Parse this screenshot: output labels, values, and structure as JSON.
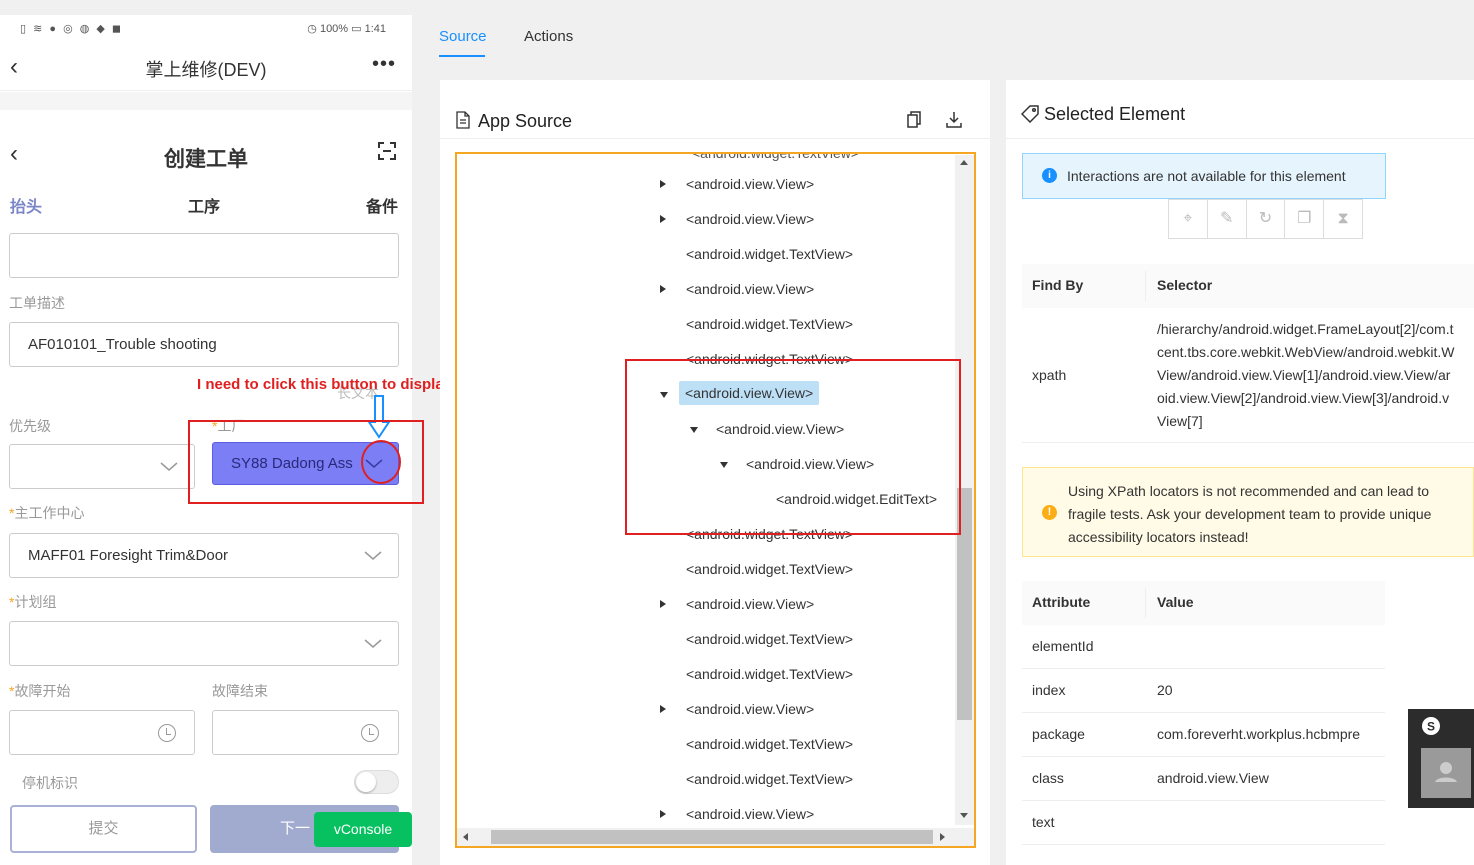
{
  "phone": {
    "status_left": "▯ ≋ ● ◎ ◍ ◆ ◼",
    "status_right": "◷ 100% ▭ 1:41",
    "app_title": "掌上维修(DEV)",
    "more": "•••",
    "page_title": "创建工单",
    "tabs": [
      "抬头",
      "工序",
      "备件"
    ],
    "desc_label": "工单描述",
    "desc_value": "AF010101_Trouble shooting",
    "priority_label": "优先级",
    "plant_label": "工厂",
    "plant_value": "SY88 Dadong Ass",
    "hidden_label": "长文本",
    "work_center_label": "主工作中心",
    "work_center_value": "MAFF01 Foresight  Trim&Door",
    "plan_group_label": "计划组",
    "fault_start_label": "故障开始",
    "fault_end_label": "故障结束",
    "downtime_label": "停机标识",
    "submit_label": "提交",
    "next_label": "下一",
    "vconsole_label": "vConsole"
  },
  "annotation": {
    "text": "I need to click this button to display dropdown list"
  },
  "tabs": {
    "source": "Source",
    "actions": "Actions"
  },
  "app_source": {
    "title": "App Source",
    "partial_top": "<android.widget.TextView>",
    "nodes": [
      {
        "label": "<android.view.View>",
        "indent": 0,
        "arrow": "right"
      },
      {
        "label": "<android.view.View>",
        "indent": 0,
        "arrow": "right"
      },
      {
        "label": "<android.widget.TextView>",
        "indent": 0,
        "arrow": ""
      },
      {
        "label": "<android.view.View>",
        "indent": 0,
        "arrow": "right"
      },
      {
        "label": "<android.widget.TextView>",
        "indent": 0,
        "arrow": ""
      },
      {
        "label": "<android.widget.TextView>",
        "indent": 0,
        "arrow": ""
      },
      {
        "label": "<android.view.View>",
        "indent": 0,
        "arrow": "down",
        "selected": true
      },
      {
        "label": "<android.view.View>",
        "indent": 1,
        "arrow": "down"
      },
      {
        "label": "<android.view.View>",
        "indent": 2,
        "arrow": "down"
      },
      {
        "label": "<android.widget.EditText>",
        "indent": 3,
        "arrow": ""
      },
      {
        "label": "<android.widget.TextView>",
        "indent": 0,
        "arrow": ""
      },
      {
        "label": "<android.widget.TextView>",
        "indent": 0,
        "arrow": ""
      },
      {
        "label": "<android.view.View>",
        "indent": 0,
        "arrow": "right"
      },
      {
        "label": "<android.widget.TextView>",
        "indent": 0,
        "arrow": ""
      },
      {
        "label": "<android.widget.TextView>",
        "indent": 0,
        "arrow": ""
      },
      {
        "label": "<android.view.View>",
        "indent": 0,
        "arrow": "right"
      },
      {
        "label": "<android.widget.TextView>",
        "indent": 0,
        "arrow": ""
      },
      {
        "label": "<android.widget.TextView>",
        "indent": 0,
        "arrow": ""
      },
      {
        "label": "<android.view.View>",
        "indent": 0,
        "arrow": "right"
      }
    ]
  },
  "selected": {
    "title": "Selected Element",
    "info": "Interactions are not available for this element",
    "find_by_header": "Find By",
    "selector_header": "Selector",
    "find_by": "xpath",
    "selector_lines": [
      "/hierarchy/android.widget.FrameLayout[2]/com.t",
      "cent.tbs.core.webkit.WebView/android.webkit.W",
      "View/android.view.View[1]/android.view.View/ar",
      "oid.view.View[2]/android.view.View[3]/android.v",
      "View[7]"
    ],
    "warning_lines": [
      "Using XPath locators is not recommended and can lead to",
      "fragile tests. Ask your development team to provide unique",
      "accessibility locators instead!"
    ],
    "attr_header": "Attribute",
    "value_header": "Value",
    "attributes": [
      {
        "name": "elementId",
        "value": ""
      },
      {
        "name": "index",
        "value": "20"
      },
      {
        "name": "package",
        "value": "com.foreverht.workplus.hcbmpre"
      },
      {
        "name": "class",
        "value": "android.view.View"
      },
      {
        "name": "text",
        "value": ""
      }
    ]
  },
  "colors": {
    "accent": "#1890ff",
    "highlight": "#7b7ef5",
    "annotation": "#e02020",
    "vconsole": "#07c160"
  }
}
